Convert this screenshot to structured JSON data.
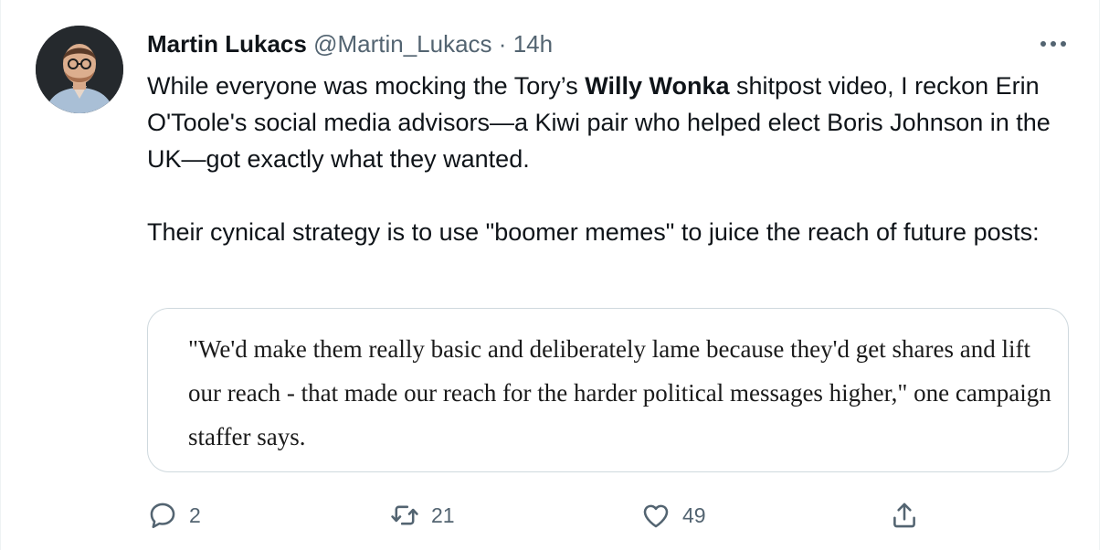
{
  "tweet": {
    "author": {
      "name": "Martin Lukacs",
      "handle": "@Martin_Lukacs",
      "separator": "·",
      "time": "14h"
    },
    "text": {
      "p1_before": "While everyone was mocking the Tory’s ",
      "p1_bold": "Willy Wonka",
      "p1_after": " shitpost video, I reckon Erin O'Toole's social media advisors—a Kiwi pair who helped elect Boris Johnson in the UK—got exactly what they wanted.",
      "p2": "Their cynical strategy is to use \"boomer memes\" to juice the reach of future posts:"
    },
    "quote": "\"We'd make them really basic and deliberately lame because they'd get shares and lift our reach - that made our reach for the harder political messages higher,\" one campaign staffer says.",
    "actions": {
      "reply": "2",
      "retweet": "21",
      "like": "49"
    },
    "icons": {
      "more": "more-horizontal-icon",
      "reply": "reply-icon",
      "retweet": "retweet-icon",
      "like": "heart-icon",
      "share": "share-icon"
    },
    "colors": {
      "text": "#0f1419",
      "secondary": "#536471",
      "border": "#cfd9de"
    }
  }
}
